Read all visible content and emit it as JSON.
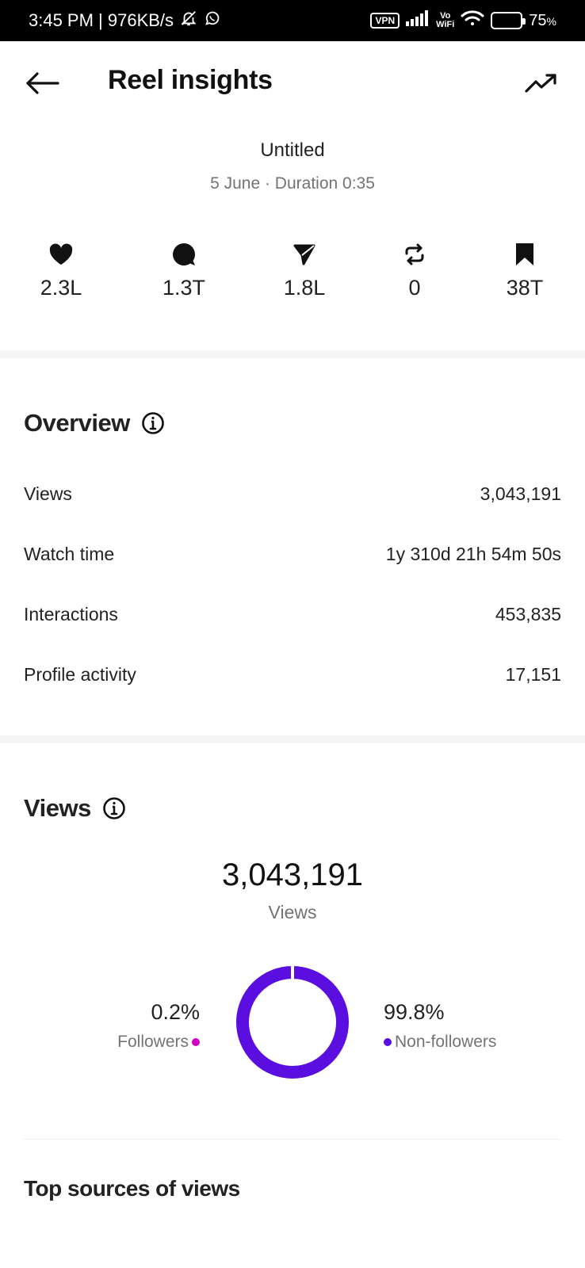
{
  "status_bar": {
    "time_speed": "3:45 PM | 976KB/s",
    "vpn": "VPN",
    "vo": "Vo",
    "wifi": "WiFi",
    "battery_pct": "75",
    "battery_unit": "%",
    "battery_level": 0.75
  },
  "header": {
    "title": "Reel insights",
    "back_icon": "arrow-left-icon",
    "trend_icon": "trending-up-icon"
  },
  "reel": {
    "title": "Untitled",
    "meta": "5 June · Duration 0:35"
  },
  "stats": [
    {
      "icon": "heart-icon",
      "value": "2.3L"
    },
    {
      "icon": "comment-icon",
      "value": "1.3T"
    },
    {
      "icon": "share-icon",
      "value": "1.8L"
    },
    {
      "icon": "repost-icon",
      "value": "0"
    },
    {
      "icon": "bookmark-icon",
      "value": "38T"
    }
  ],
  "overview": {
    "heading": "Overview",
    "rows": [
      {
        "label": "Views",
        "value": "3,043,191"
      },
      {
        "label": "Watch time",
        "value": "1y 310d 21h 54m 50s"
      },
      {
        "label": "Interactions",
        "value": "453,835"
      },
      {
        "label": "Profile activity",
        "value": "17,151"
      }
    ]
  },
  "views": {
    "heading": "Views",
    "total": "3,043,191",
    "total_label": "Views",
    "followers_pct": "0.2%",
    "followers_label": "Followers",
    "followers_fraction": 0.002,
    "nonfollowers_pct": "99.8%",
    "nonfollowers_label": "Non-followers",
    "nonfollowers_fraction": 0.998,
    "colors": {
      "followers": "#d300c5",
      "nonfollowers": "#5b0ee0"
    }
  },
  "top_sources": {
    "heading": "Top sources of views"
  }
}
